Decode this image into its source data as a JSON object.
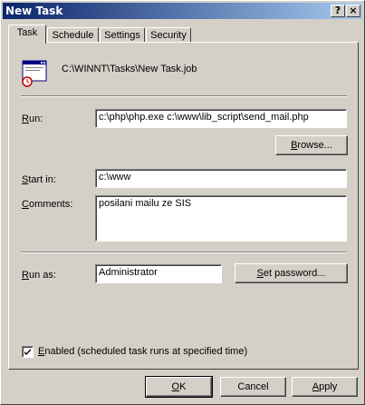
{
  "window": {
    "title": "New Task",
    "help_button": "?",
    "close_button": "×"
  },
  "tabs": [
    {
      "label": "Task",
      "active": true
    },
    {
      "label": "Schedule",
      "active": false
    },
    {
      "label": "Settings",
      "active": false
    },
    {
      "label": "Security",
      "active": false
    }
  ],
  "task": {
    "job_path": "C:\\WINNT\\Tasks\\New Task.job",
    "run": {
      "label_prefix": "R",
      "label_rest": "un:",
      "value": "c:\\php\\php.exe c:\\www\\lib_script\\send_mail.php"
    },
    "browse_button": {
      "prefix": "B",
      "rest": "rowse..."
    },
    "start_in": {
      "label_prefix": "S",
      "label_rest": "tart in:",
      "value": "c:\\www"
    },
    "comments": {
      "label_prefix": "C",
      "label_rest": "omments:",
      "value": "posilani mailu ze SIS"
    },
    "run_as": {
      "label_prefix": "R",
      "label_rest": "un as:",
      "value": "Administrator"
    },
    "set_password_button": {
      "prefix": "S",
      "rest": "et password..."
    },
    "enabled": {
      "checked": true,
      "label_prefix": "E",
      "label_rest": "nabled (scheduled task runs at specified time)"
    }
  },
  "footer": {
    "ok": {
      "prefix": "O",
      "rest": "K"
    },
    "cancel": "Cancel",
    "apply": {
      "prefix": "A",
      "rest": "pply"
    }
  },
  "colors": {
    "face": "#d4d0c8",
    "title_start": "#0a246a",
    "title_end": "#a6caf0"
  }
}
